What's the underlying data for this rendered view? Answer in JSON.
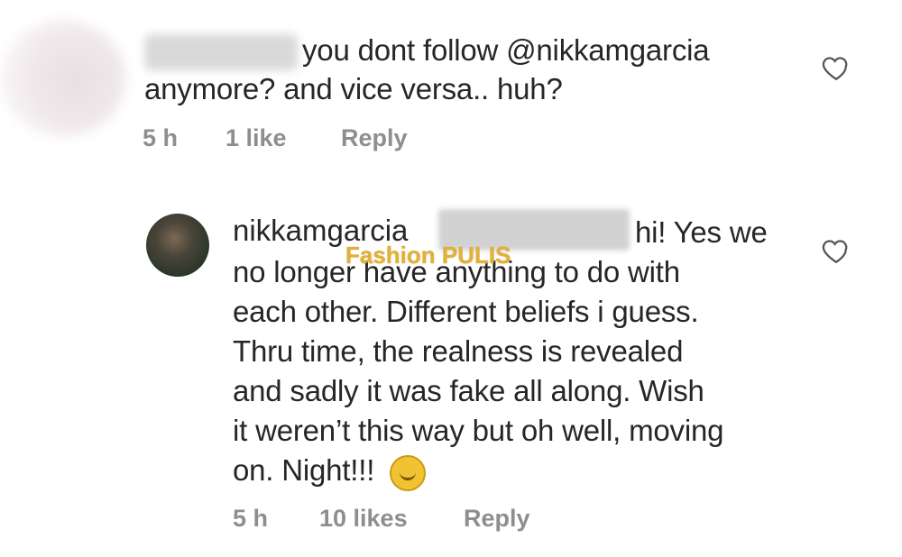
{
  "comments": [
    {
      "text_line1": "you dont follow @nikkamgarcia",
      "text_line2": "anymore? and vice versa.. huh?",
      "time": "5 h",
      "likes": "1 like",
      "reply": "Reply"
    },
    {
      "username": "nikkamgarcia",
      "lines": [
        "hi! Yes we",
        "no longer have anything to do with",
        "each other. Different beliefs i guess.",
        "Thru time, the  realness is revealed",
        "and sadly it was fake all along. Wish",
        "it weren’t this way but oh well, moving",
        "on. Night!!!"
      ],
      "time": "5 h",
      "likes": "10 likes",
      "reply": "Reply"
    }
  ],
  "watermark": "Fashion PULIS",
  "icons": {
    "like": "heart-icon",
    "emoji": "smiley-emoji-icon"
  }
}
